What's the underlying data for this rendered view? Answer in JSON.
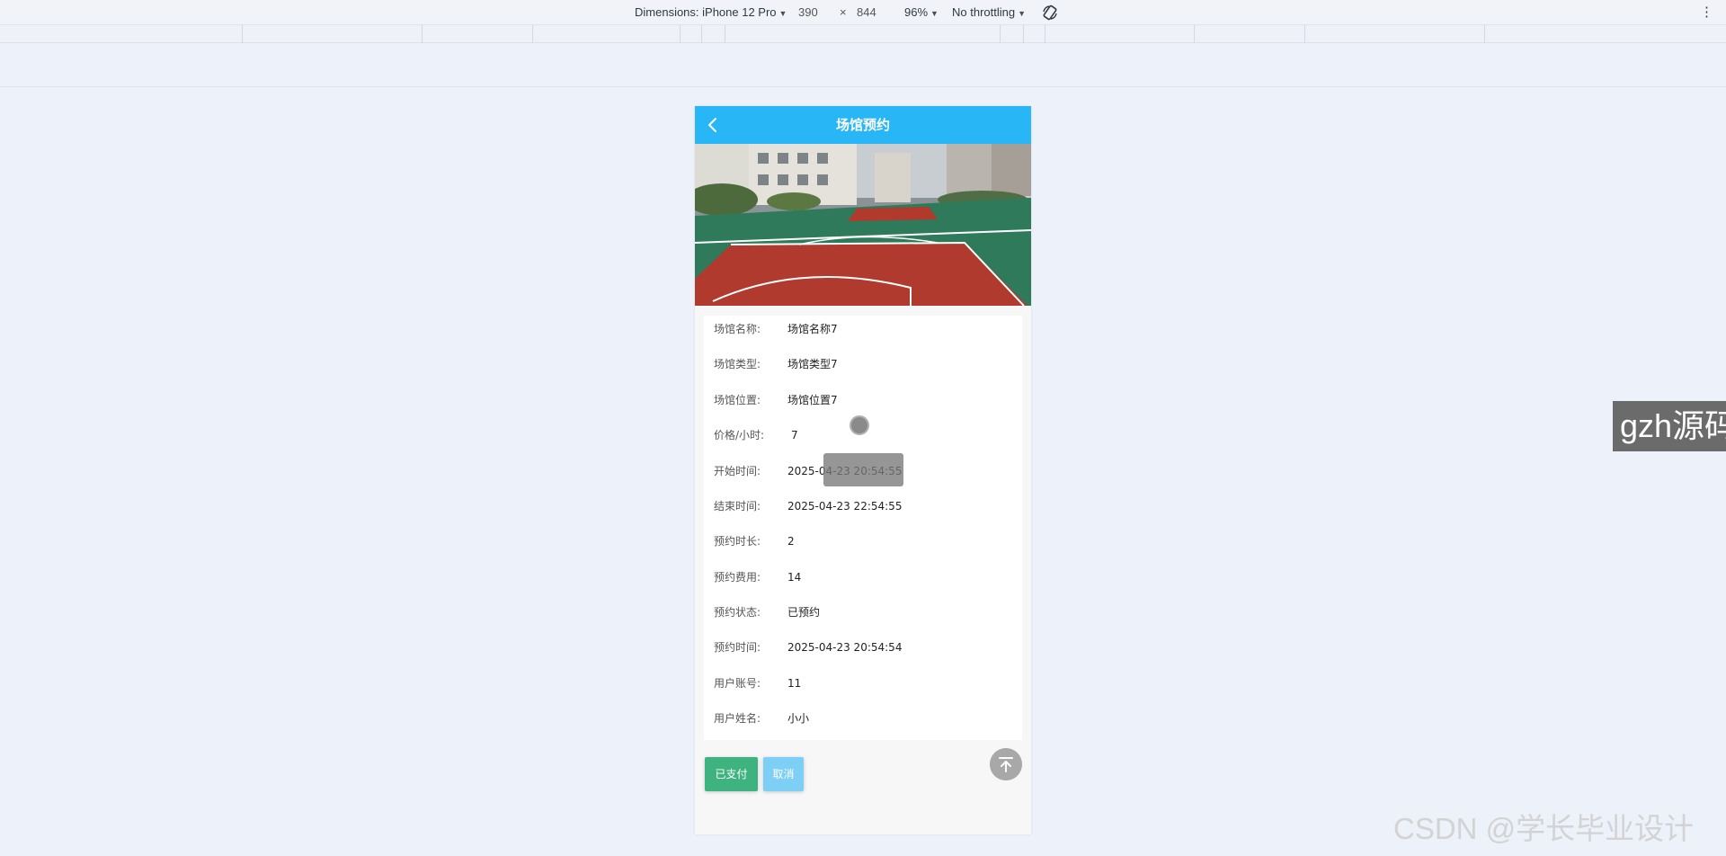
{
  "devtools": {
    "dimensions_label": "Dimensions: iPhone 12 Pro",
    "width": "390",
    "times": "×",
    "height": "844",
    "zoom": "96%",
    "throttling": "No throttling"
  },
  "app": {
    "title": "场馆预约",
    "header_color": "#29b6f6"
  },
  "details": [
    {
      "label": "场馆名称:",
      "value": "场馆名称7"
    },
    {
      "label": "场馆类型:",
      "value": "场馆类型7"
    },
    {
      "label": "场馆位置:",
      "value": "场馆位置7"
    },
    {
      "label": "价格/小时:",
      "value": "7"
    },
    {
      "label": "开始时间:",
      "value": "2025-04-23 20:54:55"
    },
    {
      "label": "结束时间:",
      "value": "2025-04-23 22:54:55"
    },
    {
      "label": "预约时长:",
      "value": "2"
    },
    {
      "label": "预约费用:",
      "value": "14"
    },
    {
      "label": "预约状态:",
      "value": "已预约"
    },
    {
      "label": "预约时间:",
      "value": "2025-04-23 20:54:54"
    },
    {
      "label": "用户账号:",
      "value": "11"
    },
    {
      "label": "用户姓名:",
      "value": "小小"
    }
  ],
  "actions": {
    "paid_label": "已支付",
    "cancel_label": "取消"
  },
  "watermarks": {
    "box": "gzh源码",
    "csdn": "CSDN @学长毕业设计"
  }
}
